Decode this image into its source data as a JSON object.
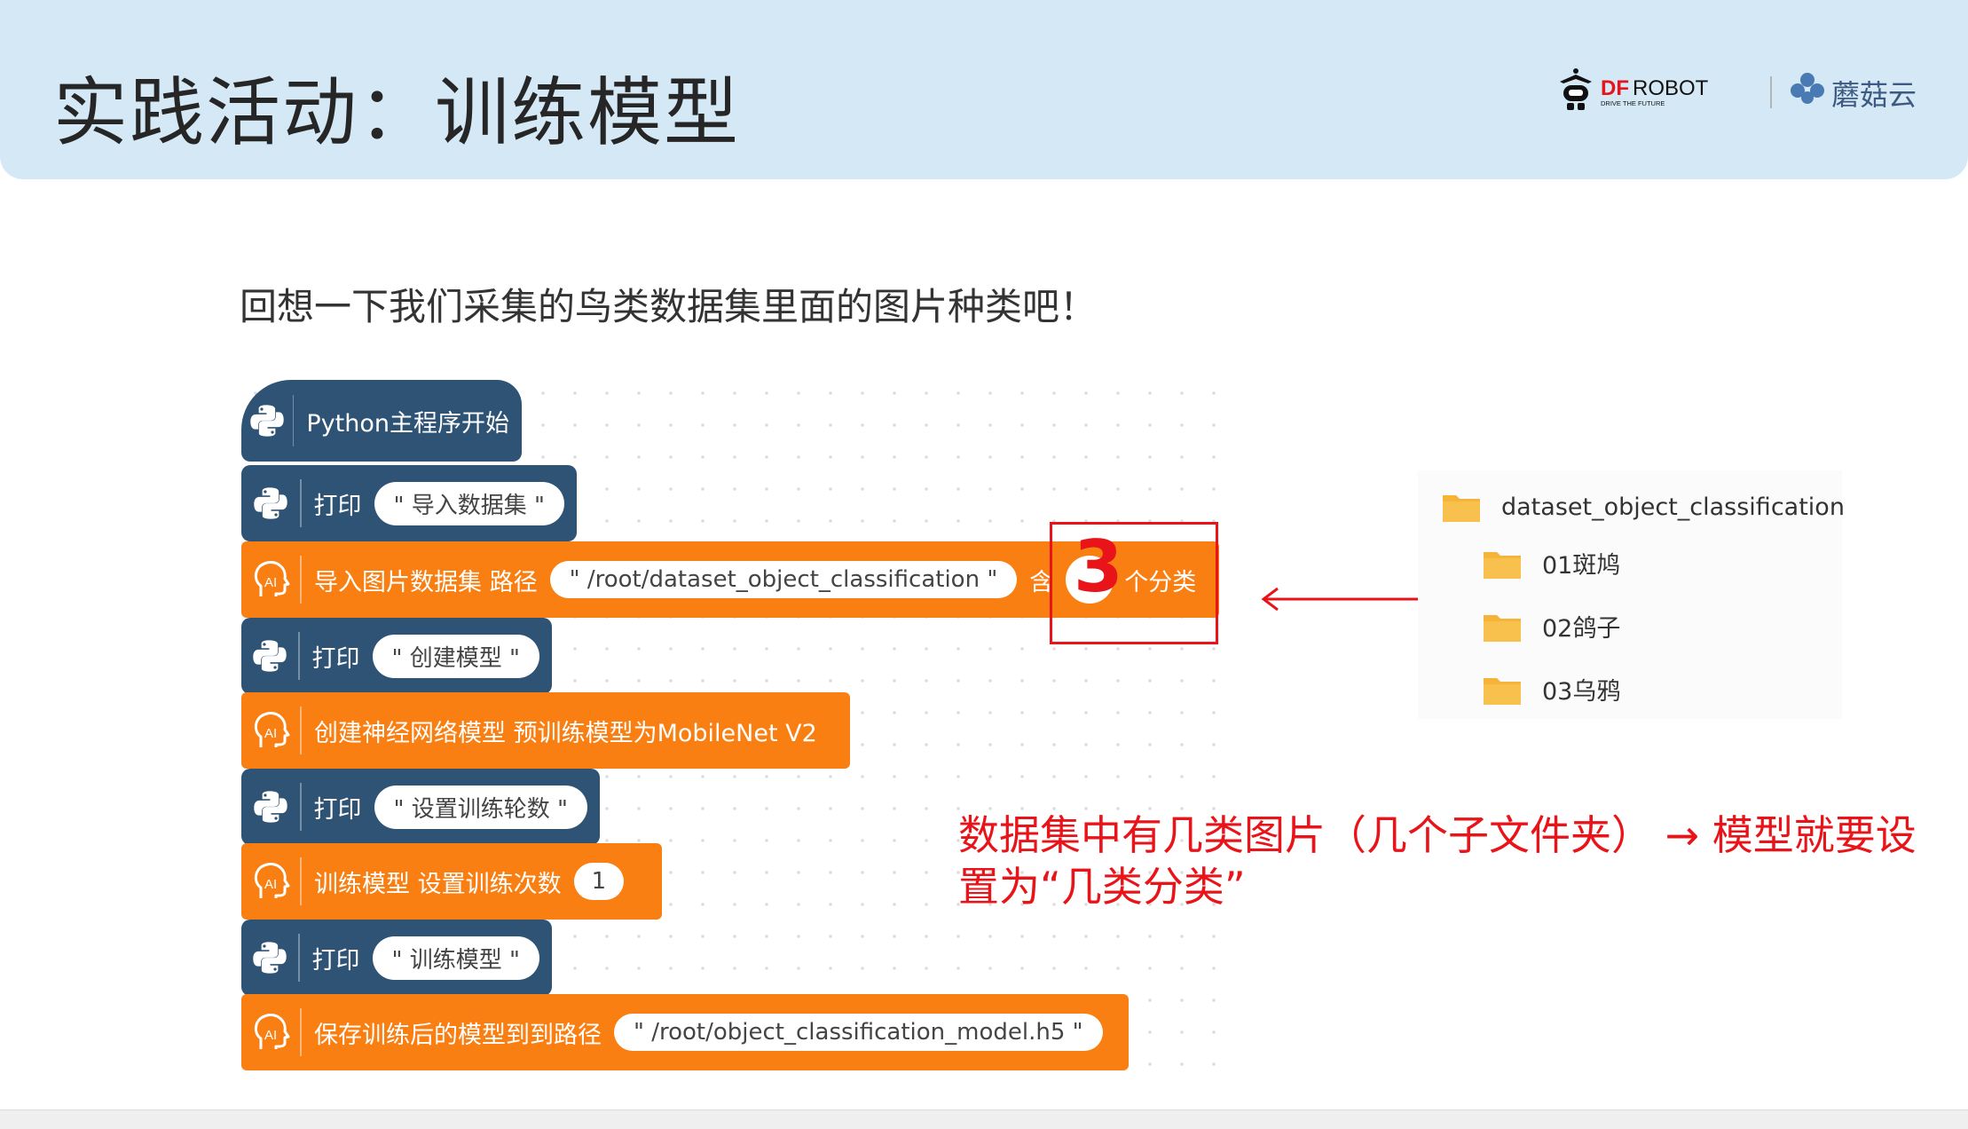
{
  "header": {
    "title": "实践活动：训练模型",
    "logo_dfrobot": "DFROBOT",
    "logo_dfrobot_tagline": "DRIVE THE FUTURE",
    "logo_mushroom": "蘑菇云"
  },
  "subtitle": "回想一下我们采集的鸟类数据集里面的图片种类吧！",
  "blocks": {
    "start": "Python主程序开始",
    "print1_label": "打印",
    "print1_value": "\" 导入数据集 \"",
    "import_label": "导入图片数据集 路径",
    "import_path": "\" /root/dataset_object_classification \"",
    "import_contains": "含",
    "import_categories": "个分类",
    "print2_label": "打印",
    "print2_value": "\" 创建模型 \"",
    "create_model": "创建神经网络模型 预训练模型为MobileNet V2",
    "print3_label": "打印",
    "print3_value": "\" 设置训练轮数 \"",
    "train_label": "训练模型 设置训练次数",
    "train_epochs": "1",
    "print4_label": "打印",
    "print4_value": "\" 训练模型 \"",
    "save_label": "保存训练后的模型到到路径",
    "save_path": "\" /root/object_classification_model.h5 \""
  },
  "annotation": {
    "number": "3",
    "note": "数据集中有几类图片（几个子文件夹） → 模型就要设置为“几类分类”"
  },
  "file_panel": {
    "root": "dataset_object_classification",
    "folders": [
      "01斑鸠",
      "02鸽子",
      "03乌鸦"
    ]
  },
  "colors": {
    "python_block": "#2e5375",
    "ai_block": "#f97f12",
    "annotation_red": "#e8141a",
    "folder": "#f6b33a"
  }
}
